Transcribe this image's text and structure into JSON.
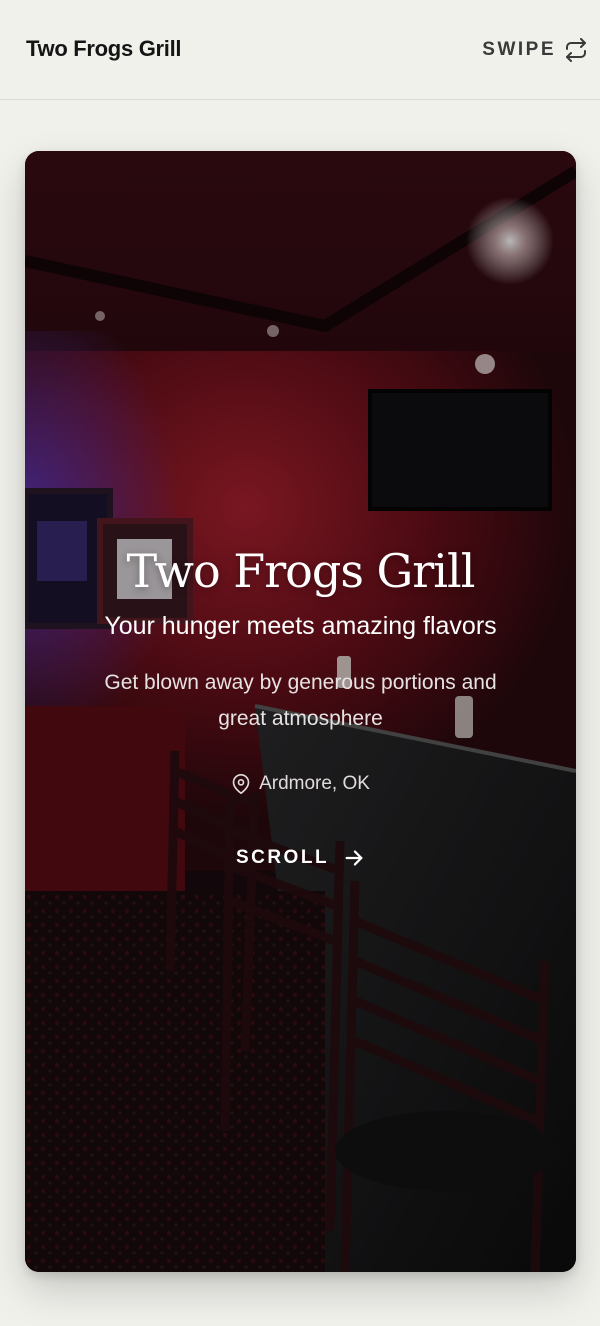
{
  "header": {
    "brand": "Two Frogs Grill",
    "swipe_label": "SWIPE",
    "swipe_icon": "repeat-arrows-icon"
  },
  "hero": {
    "title": "Two Frogs Grill",
    "subtitle": "Your hunger meets amazing flavors",
    "description": "Get blown away by generous portions and great atmosphere",
    "location": "Ardmore, OK",
    "location_icon": "map-pin-icon",
    "scroll_label": "SCROLL",
    "scroll_icon": "arrow-right-icon",
    "background_image": "restaurant-bar-interior-photo"
  },
  "colors": {
    "page_background": "#f1f1ec",
    "text_dark": "#151515",
    "hero_text": "#ffffff",
    "interior_red": "#7a1420"
  }
}
